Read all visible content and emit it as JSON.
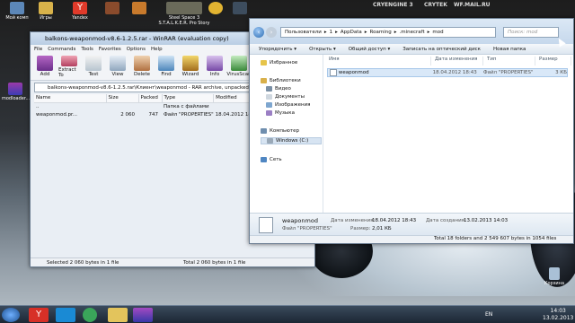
{
  "desktop": {
    "top_icons": [
      "Мой комп",
      "Игры",
      "Yandex",
      "",
      "",
      "",
      "",
      ""
    ],
    "grail": "Steel Space 3 S.T.A.L.K.E.R. Pro Story",
    "logos": [
      "CRYENGINE 3",
      "CRYTEK",
      "WF.MAIL.RU"
    ],
    "left_icon": "modloader...",
    "recycle_bin": "Корзина"
  },
  "winrar": {
    "title": "balkons-weaponmod-v8.6-1.2.5.rar - WinRAR (evaluation copy)",
    "menu": [
      "File",
      "Commands",
      "Tools",
      "Favorites",
      "Options",
      "Help"
    ],
    "toolbar": [
      "Add",
      "Extract To",
      "Test",
      "View",
      "Delete",
      "Find",
      "Wizard",
      "Info",
      "VirusScan"
    ],
    "path": "balkons-weaponmod-v8.6-1.2.5.rar\\Клиент\\weaponmod - RAR archive, unpacked...",
    "columns": [
      "Name",
      "Size",
      "Packed",
      "Type",
      "Modified"
    ],
    "rows": [
      {
        "name": "..",
        "size": "",
        "packed": "",
        "type": "Папка с файлами",
        "modified": ""
      },
      {
        "name": "weaponmod.pr...",
        "size": "2 060",
        "packed": "747",
        "type": "Файл \"PROPERTIES\"",
        "modified": "18.04.2012 18:43"
      }
    ],
    "status_left": "Selected 2 060 bytes in 1 file",
    "status_right": "Total 2 060 bytes in 1 file"
  },
  "explorer": {
    "address": [
      "Пользователи",
      "1",
      "AppData",
      "Roaming",
      ".minecraft",
      "mod"
    ],
    "search_placeholder": "Поиск: mod",
    "commands": [
      "Упорядочить ▾",
      "Открыть ▾",
      "Общий доступ ▾",
      "Записать на оптический диск",
      "Новая папка"
    ],
    "sidebar": {
      "favorites": "Избранное",
      "libraries": "Библиотеки",
      "video": "Видео",
      "docs": "Документы",
      "images": "Изображения",
      "music": "Музыка",
      "computer": "Компьютер",
      "drive": "Windows (C:)",
      "network": "Сеть"
    },
    "columns": [
      "Имя",
      "Дата изменения",
      "Тип",
      "Размер"
    ],
    "file": {
      "name": "weaponmod",
      "date": "18.04.2012 18:43",
      "type": "Файл \"PROPERTIES\"",
      "size": "3 КБ"
    },
    "details": {
      "name": "weaponmod",
      "type": "Файл \"PROPERTIES\"",
      "modified_label": "Дата изменения:",
      "modified": "18.04.2012 18:43",
      "created_label": "Дата создания:",
      "created": "13.02.2013 14:03",
      "size_label": "Размер:",
      "size": "2,01 КБ"
    },
    "status": "Total 18 folders and 2 549 607 bytes in 1054 files"
  },
  "taskbar": {
    "time": "14:03",
    "date": "13.02.2013",
    "lang": "EN"
  }
}
